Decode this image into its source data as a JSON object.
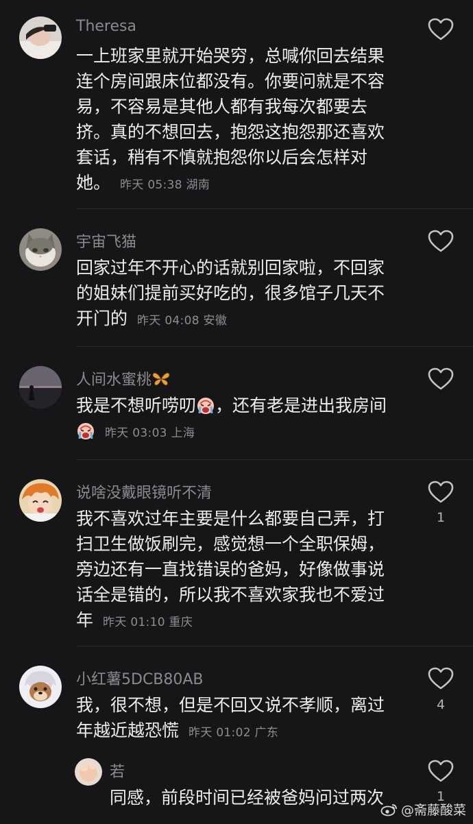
{
  "comments": [
    {
      "username": "Theresa",
      "text": "一上班家里就开始哭穷，总喊你回去结果连个房间跟床位都没有。你要问就是不容易，不容易是其他人都有我每次都要去挤。真的不想回去，抱怨这抱怨那还喜欢套话，稍有不慎就抱怨你以后会怎样对她。",
      "time": "昨天 05:38",
      "location": "湖南",
      "likes": ""
    },
    {
      "username": "宇宙飞猫",
      "text": "回家过年不开心的话就别回家啦，不回家的姐妹们提前买好吃的，很多馆子几天不开门的",
      "time": "昨天 04:08",
      "location": "安徽",
      "likes": ""
    },
    {
      "username": "人间水蜜桃",
      "username_emoji": "butterfly-emoji",
      "text_a": "我是不想听唠叨",
      "text_b": "，还有老是进出我房间",
      "time": "昨天 03:03",
      "location": "上海",
      "likes": ""
    },
    {
      "username": "说啥没戴眼镜听不清",
      "text": "我不喜欢过年主要是什么都要自己弄，打扫卫生做饭刷完，感觉想一个全职保姆，旁边还有一直找错误的爸妈，好像做事说话全是错的，所以我不喜欢家我也不爱过年",
      "time": "昨天 01:10",
      "location": "重庆",
      "likes": "1"
    },
    {
      "username": "小红薯5DCB80AB",
      "text": "我，很不想，但是不回又说不孝顺，离过年越近越恐慌",
      "time": "昨天 01:02",
      "location": "广东",
      "likes": "4"
    }
  ],
  "reply": {
    "username": "若",
    "text": "同感，前段时间已经被爸妈问过两次",
    "likes": "1"
  },
  "watermark": "@斋藤酸菜",
  "icons": {
    "like": "heart-outline-icon",
    "crying": "crying-face-emoji",
    "weibo": "weibo-logo-icon"
  },
  "colors": {
    "background": "#161618",
    "text": "#ededed",
    "muted": "#8a8a8f"
  }
}
